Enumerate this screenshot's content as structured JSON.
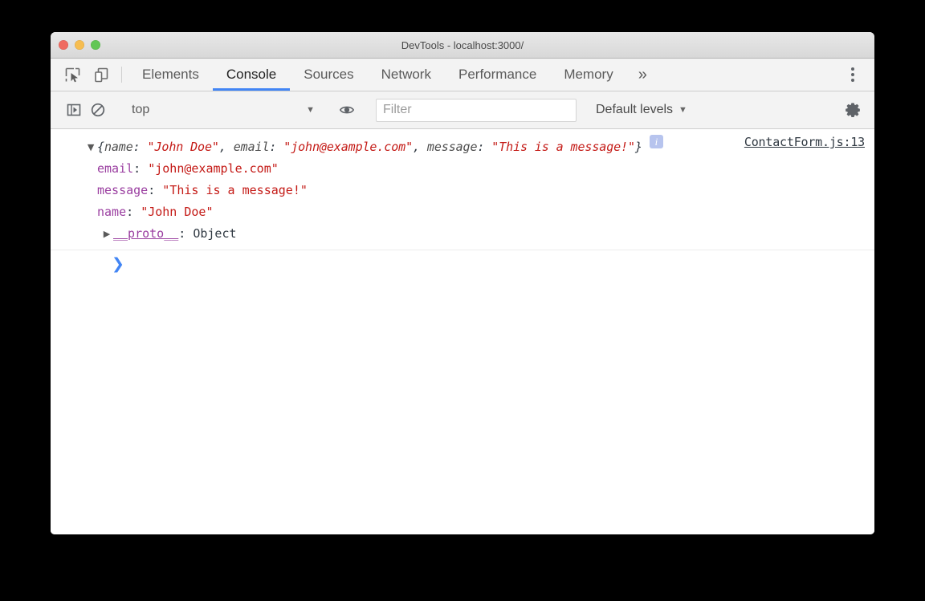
{
  "window": {
    "title": "DevTools - localhost:3000/",
    "traffic_lights": [
      {
        "name": "close",
        "color": "#ef6a60"
      },
      {
        "name": "minimize",
        "color": "#f6bd50"
      },
      {
        "name": "maximize",
        "color": "#62c655"
      }
    ]
  },
  "tabbar": {
    "icons": [
      {
        "name": "inspect-element-icon"
      },
      {
        "name": "device-toolbar-icon"
      }
    ],
    "tabs": [
      {
        "label": "Elements",
        "active": false
      },
      {
        "label": "Console",
        "active": true
      },
      {
        "label": "Sources",
        "active": false
      },
      {
        "label": "Network",
        "active": false
      },
      {
        "label": "Performance",
        "active": false
      },
      {
        "label": "Memory",
        "active": false
      }
    ],
    "more_label": "»",
    "menu_label": "Customize and control DevTools",
    "active_accent": "#4285f4"
  },
  "console_toolbar": {
    "sidebar_toggle": "console-sidebar-icon",
    "clear_console": "clear-console-icon",
    "context": {
      "value": "top",
      "caret": "▼"
    },
    "eye_icon": "live-expression-icon",
    "filter": {
      "value": "",
      "placeholder": "Filter"
    },
    "levels": {
      "value": "Default levels",
      "caret": "▼"
    },
    "settings": "settings-gear-icon"
  },
  "console": {
    "source_link": "ContactForm.js:13",
    "expand_open": "▼",
    "expand_closed": "▶",
    "preview": {
      "open_brace": "{",
      "close_brace": "}",
      "parts": [
        {
          "key": "name",
          "value": "\"John Doe\"",
          "sep": ", "
        },
        {
          "key": "email",
          "value": "\"john@example.com\"",
          "sep": ", "
        },
        {
          "key": "message",
          "value": "\"This is a message!\"",
          "sep": ""
        }
      ]
    },
    "badge": {
      "label": "i",
      "color": "#b7c4ee"
    },
    "properties": [
      {
        "key": "email",
        "value": "\"john@example.com\""
      },
      {
        "key": "message",
        "value": "\"This is a message!\""
      },
      {
        "key": "name",
        "value": "\"John Doe\""
      }
    ],
    "proto": {
      "key": "__proto__",
      "value": "Object"
    },
    "prompt": "❯",
    "colors": {
      "string": "#c41a16",
      "property": "#9a3ea0",
      "punctuation": "#303942"
    }
  }
}
